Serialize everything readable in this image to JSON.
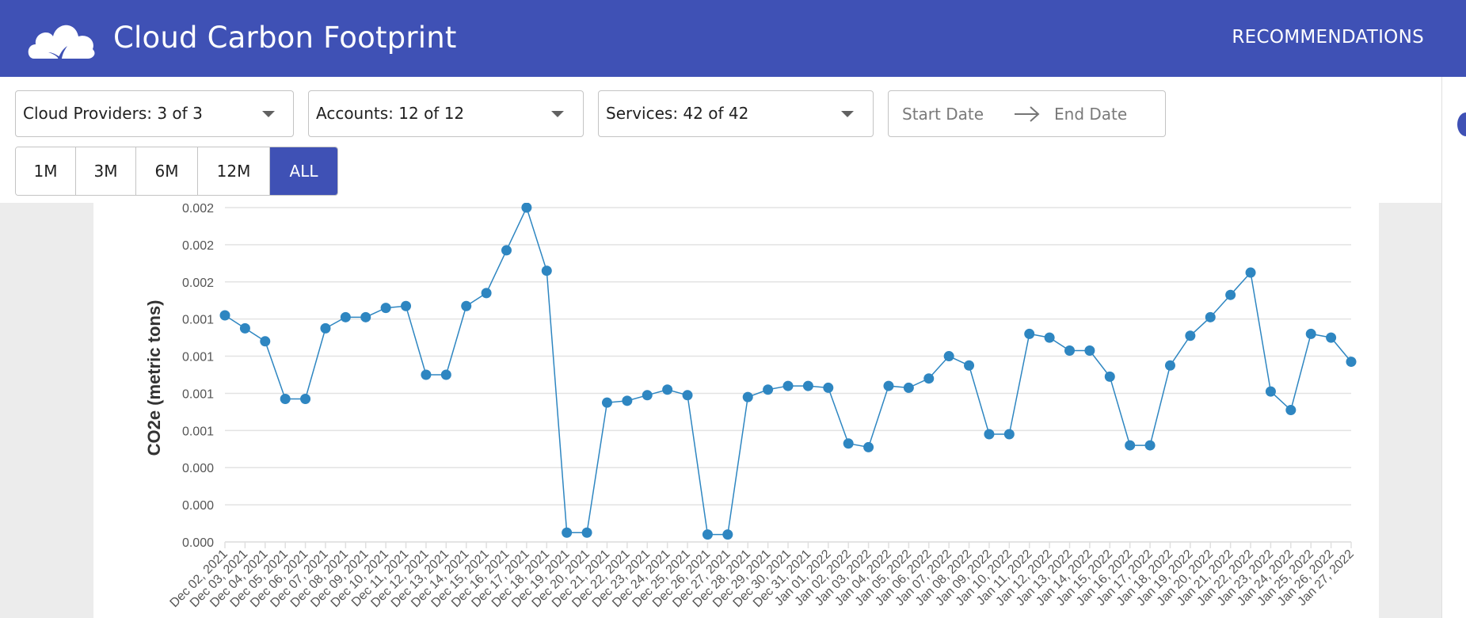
{
  "app": {
    "title": "Cloud Carbon Footprint",
    "nav_recommendations": "RECOMMENDATIONS",
    "brand_color": "#3f51b5",
    "logo_icon": "cloud-leaf-icon"
  },
  "filters": {
    "cloud_providers": "Cloud Providers: 3 of 3",
    "accounts": "Accounts: 12 of 12",
    "services": "Services: 42 of 42",
    "start_date_placeholder": "Start Date",
    "end_date_placeholder": "End Date"
  },
  "ranges": {
    "options": [
      "1M",
      "3M",
      "6M",
      "12M",
      "ALL"
    ],
    "selected": "ALL"
  },
  "chart_data": {
    "type": "line",
    "ylabel": "CO2e (metric tons)",
    "ytick_labels": [
      "0.000",
      "0.000",
      "0.000",
      "0.001",
      "0.001",
      "0.001",
      "0.001",
      "0.002",
      "0.002",
      "0.002"
    ],
    "ylim": [
      0,
      0.0018
    ],
    "grid": true,
    "point_color": "#2e86c1",
    "x": [
      "Dec 02, 2021",
      "Dec 03, 2021",
      "Dec 04, 2021",
      "Dec 05, 2021",
      "Dec 06, 2021",
      "Dec 07, 2021",
      "Dec 08, 2021",
      "Dec 09, 2021",
      "Dec 10, 2021",
      "Dec 11, 2021",
      "Dec 12, 2021",
      "Dec 13, 2021",
      "Dec 14, 2021",
      "Dec 15, 2021",
      "Dec 16, 2021",
      "Dec 17, 2021",
      "Dec 18, 2021",
      "Dec 19, 2021",
      "Dec 20, 2021",
      "Dec 21, 2021",
      "Dec 22, 2021",
      "Dec 23, 2021",
      "Dec 24, 2021",
      "Dec 25, 2021",
      "Dec 26, 2021",
      "Dec 27, 2021",
      "Dec 28, 2021",
      "Dec 29, 2021",
      "Dec 30, 2021",
      "Dec 31, 2021",
      "Jan 01, 2022",
      "Jan 02, 2022",
      "Jan 03, 2022",
      "Jan 04, 2022",
      "Jan 05, 2022",
      "Jan 06, 2022",
      "Jan 07, 2022",
      "Jan 08, 2022",
      "Jan 09, 2022",
      "Jan 10, 2022",
      "Jan 11, 2022",
      "Jan 12, 2022",
      "Jan 13, 2022",
      "Jan 14, 2022",
      "Jan 15, 2022",
      "Jan 16, 2022",
      "Jan 17, 2022",
      "Jan 18, 2022",
      "Jan 19, 2022",
      "Jan 20, 2022",
      "Jan 21, 2022",
      "Jan 22, 2022",
      "Jan 23, 2022",
      "Jan 24, 2022",
      "Jan 25, 2022",
      "Jan 26, 2022",
      "Jan 27, 2022"
    ],
    "values": [
      0.00122,
      0.00115,
      0.00108,
      0.00077,
      0.00077,
      0.00115,
      0.00121,
      0.00121,
      0.00126,
      0.00127,
      0.0009,
      0.0009,
      0.00127,
      0.00134,
      0.00157,
      0.0018,
      0.00146,
      5e-05,
      5e-05,
      0.00075,
      0.00076,
      0.00079,
      0.00082,
      0.00079,
      4e-05,
      4e-05,
      0.00078,
      0.00082,
      0.00084,
      0.00084,
      0.00083,
      0.00053,
      0.00051,
      0.00084,
      0.00083,
      0.00088,
      0.001,
      0.00095,
      0.00058,
      0.00058,
      0.00112,
      0.0011,
      0.00103,
      0.00103,
      0.00089,
      0.00052,
      0.00052,
      0.00095,
      0.00111,
      0.00121,
      0.00133,
      0.00145,
      0.00081,
      0.00071,
      0.00112,
      0.0011,
      0.00097
    ]
  }
}
